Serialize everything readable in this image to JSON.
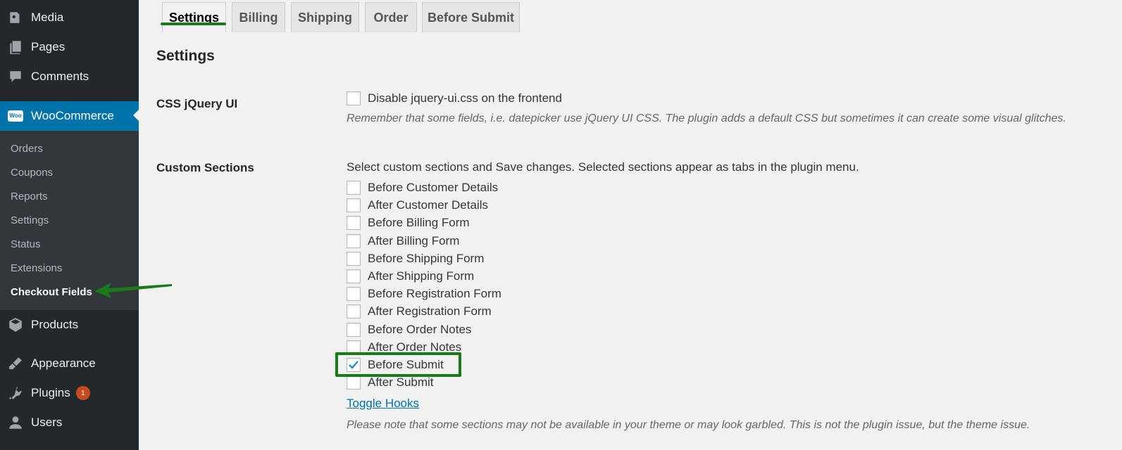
{
  "sidebar": {
    "items": [
      {
        "label": "Media",
        "icon": "media-icon"
      },
      {
        "label": "Pages",
        "icon": "pages-icon"
      },
      {
        "label": "Comments",
        "icon": "comments-icon"
      },
      {
        "label": "WooCommerce",
        "icon": "woo-icon"
      },
      {
        "label": "Products",
        "icon": "products-icon"
      },
      {
        "label": "Appearance",
        "icon": "appearance-icon"
      },
      {
        "label": "Plugins",
        "icon": "plugins-icon",
        "badge": "1"
      },
      {
        "label": "Users",
        "icon": "users-icon"
      }
    ],
    "woo_icon_text": "Woo",
    "submenu": [
      "Orders",
      "Coupons",
      "Reports",
      "Settings",
      "Status",
      "Extensions",
      "Checkout Fields"
    ]
  },
  "tabs": [
    "Settings",
    "Billing",
    "Shipping",
    "Order",
    "Before Submit"
  ],
  "page_heading": "Settings",
  "css_section": {
    "label": "CSS jQuery UI",
    "checkbox_label": "Disable jquery-ui.css on the frontend",
    "description": "Remember that some fields, i.e. datepicker use jQuery UI CSS. The plugin adds a default CSS but sometimes it can create some visual glitches."
  },
  "custom_sections": {
    "label": "Custom Sections",
    "intro": "Select custom sections and Save changes. Selected sections appear as tabs in the plugin menu.",
    "options": [
      {
        "label": "Before Customer Details",
        "checked": false
      },
      {
        "label": "After Customer Details",
        "checked": false
      },
      {
        "label": "Before Billing Form",
        "checked": false
      },
      {
        "label": "After Billing Form",
        "checked": false
      },
      {
        "label": "Before Shipping Form",
        "checked": false
      },
      {
        "label": "After Shipping Form",
        "checked": false
      },
      {
        "label": "Before Registration Form",
        "checked": false
      },
      {
        "label": "After Registration Form",
        "checked": false
      },
      {
        "label": "Before Order Notes",
        "checked": false
      },
      {
        "label": "After Order Notes",
        "checked": false
      },
      {
        "label": "Before Submit",
        "checked": true
      },
      {
        "label": "After Submit",
        "checked": false
      }
    ],
    "toggle_link": "Toggle Hooks",
    "note": "Please note that some sections may not be available in your theme or may look garbled. This is not the plugin issue, but the theme issue."
  },
  "colors": {
    "sidebar_bg": "#23282d",
    "active_menu": "#0073aa",
    "annotation_green": "#1a7a1a",
    "badge": "#ca4a1f"
  }
}
